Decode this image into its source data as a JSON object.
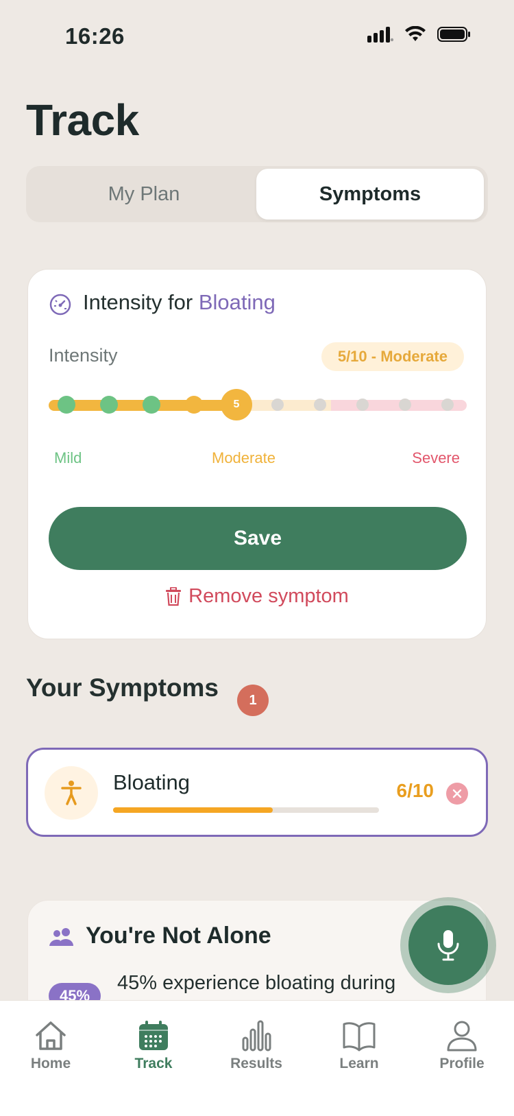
{
  "status_bar": {
    "time": "16:26"
  },
  "page": {
    "title": "Track"
  },
  "segmented": {
    "tabs": [
      "My Plan",
      "Symptoms"
    ],
    "selected": "Symptoms"
  },
  "intensity_card": {
    "title_prefix": "Intensity for ",
    "symptom": "Bloating",
    "intensity_label": "Intensity",
    "badge": "5/10 - Moderate",
    "value": 5,
    "max": 10,
    "selected_label": "5",
    "scale_labels": {
      "mild": "Mild",
      "moderate": "Moderate",
      "severe": "Severe"
    },
    "save_label": "Save",
    "remove_label": "Remove symptom"
  },
  "symptoms": {
    "heading": "Your Symptoms",
    "count": "1",
    "items": [
      {
        "name": "Bloating",
        "score": "6/10",
        "level": 0.6,
        "icon": "person-icon"
      }
    ]
  },
  "alone": {
    "title": "You're Not Alone",
    "stat_pill": "45%",
    "stat_text": "45% experience bloating during"
  },
  "nav": {
    "items": [
      {
        "label": "Home",
        "icon": "home-icon"
      },
      {
        "label": "Track",
        "icon": "calendar-icon"
      },
      {
        "label": "Results",
        "icon": "bar-chart-icon"
      },
      {
        "label": "Learn",
        "icon": "book-icon"
      },
      {
        "label": "Profile",
        "icon": "profile-icon"
      }
    ],
    "active": "Track"
  },
  "colors": {
    "background": "#EEE9E4",
    "primary_green": "#3F7D5E",
    "accent_purple": "#7E69B7",
    "moderate_amber": "#F0B23A",
    "mild_green": "#6DC384",
    "severe_red": "#E2566B"
  }
}
